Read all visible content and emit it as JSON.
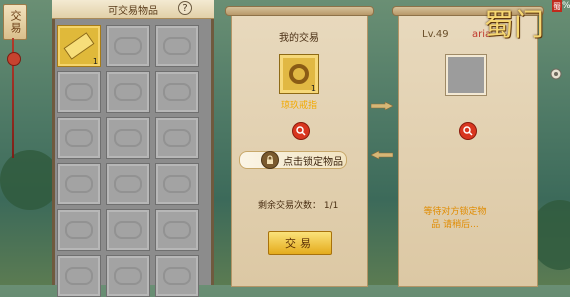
{
  "side_tag": {
    "label": "交易"
  },
  "inventory": {
    "title": "可交易物品",
    "help": "?",
    "slots": [
      {
        "filled": true,
        "qty": "1"
      },
      {
        "filled": false
      },
      {
        "filled": false
      },
      {
        "filled": false
      },
      {
        "filled": false
      },
      {
        "filled": false
      },
      {
        "filled": false
      },
      {
        "filled": false
      },
      {
        "filled": false
      },
      {
        "filled": false
      },
      {
        "filled": false
      },
      {
        "filled": false
      },
      {
        "filled": false
      },
      {
        "filled": false
      },
      {
        "filled": false
      },
      {
        "filled": false
      },
      {
        "filled": false
      },
      {
        "filled": false
      }
    ]
  },
  "my_trade": {
    "title": "我的交易",
    "item_name": "琼玖戒指",
    "item_qty": "1",
    "lock_label": "点击锁定物品",
    "remaining_label": "剩余交易次数：",
    "remaining_value": "1/1",
    "trade_button": "交易"
  },
  "other_trade": {
    "level": "Lv.49",
    "player_name": "aria",
    "waiting_text": "等待对方锁定物品 请稍后..."
  },
  "game_logo": {
    "text": "蜀门",
    "badge": "蜀",
    "percent": "%"
  },
  "colors": {
    "accent_gold": "#e4ab1c",
    "name_red": "#c0392b",
    "panel_bg": "#e8d9bd"
  }
}
